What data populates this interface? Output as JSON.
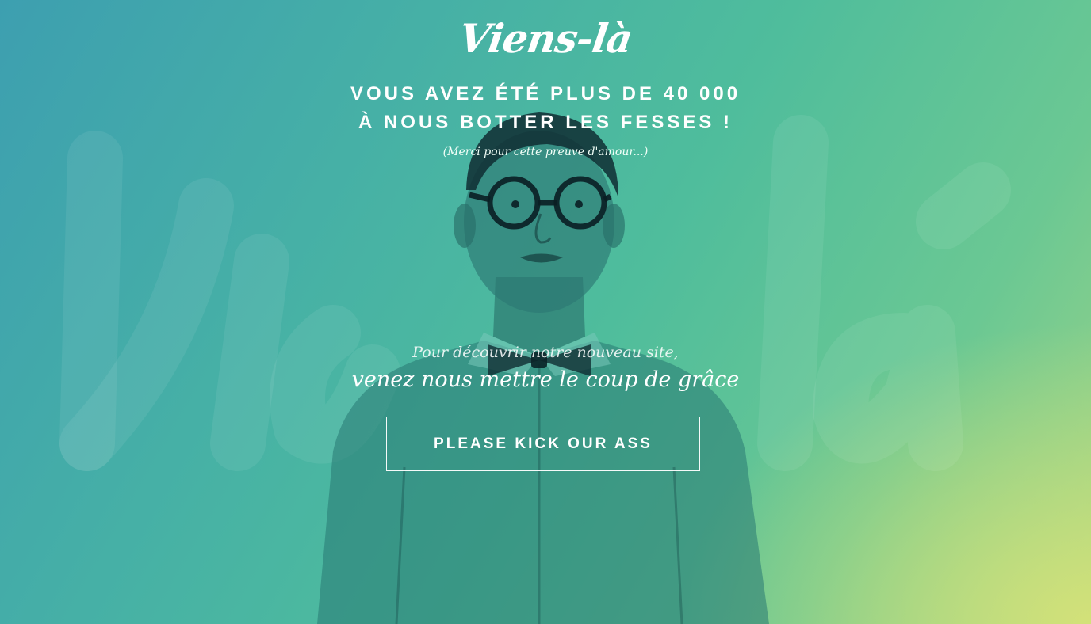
{
  "brand": {
    "logo_text": "Viens-là"
  },
  "hero": {
    "headline_line1": "VOUS AVEZ ÉTÉ PLUS DE 40 000",
    "headline_line2": "À NOUS BOTTER LES FESSES !",
    "thanks": "(Merci pour cette preuve d'amour...)",
    "invite": "Pour découvrir notre nouveau site,",
    "invite_strong": "venez nous mettre le coup de grâce",
    "cta_label": "PLEASE KICK OUR ASS"
  },
  "colors": {
    "gradient_start": "#3d9fb0",
    "gradient_mid": "#4fbd9c",
    "gradient_end": "#d6e278",
    "text": "#ffffff"
  },
  "images": {
    "person": "person-with-glasses-and-bow-tie",
    "watermark": "viens-la-watermark"
  }
}
